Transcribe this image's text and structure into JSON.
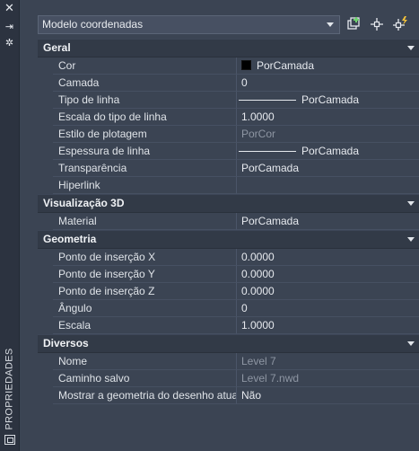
{
  "window": {
    "vertical_title": "PROPRIEDADES"
  },
  "toolbar": {
    "selection_label": "Modelo coordenadas"
  },
  "categories": [
    {
      "name": "Geral",
      "rows": [
        {
          "label": "Cor",
          "value": "PorCamada",
          "kind": "color",
          "swatch": "#000000"
        },
        {
          "label": "Camada",
          "value": "0"
        },
        {
          "label": "Tipo de linha",
          "value": "PorCamada",
          "kind": "line"
        },
        {
          "label": "Escala do tipo de linha",
          "value": "1.0000"
        },
        {
          "label": "Estilo de plotagem",
          "value": "PorCor",
          "dim": true
        },
        {
          "label": "Espessura de linha",
          "value": "PorCamada",
          "kind": "line"
        },
        {
          "label": "Transparência",
          "value": "PorCamada"
        },
        {
          "label": "Hiperlink",
          "value": ""
        }
      ]
    },
    {
      "name": "Visualização 3D",
      "rows": [
        {
          "label": "Material",
          "value": "PorCamada"
        }
      ]
    },
    {
      "name": "Geometria",
      "rows": [
        {
          "label": "Ponto de inserção X",
          "value": "0.0000"
        },
        {
          "label": "Ponto de inserção Y",
          "value": "0.0000"
        },
        {
          "label": "Ponto de inserção Z",
          "value": "0.0000"
        },
        {
          "label": "Ângulo",
          "value": "0"
        },
        {
          "label": "Escala",
          "value": "1.0000"
        }
      ]
    },
    {
      "name": "Diversos",
      "rows": [
        {
          "label": "Nome",
          "value": "Level 7",
          "dim": true
        },
        {
          "label": "Caminho salvo",
          "value": "Level 7.nwd",
          "dim": true
        },
        {
          "label": "Mostrar a geometria do desenho atual",
          "value": "Não"
        }
      ]
    }
  ]
}
